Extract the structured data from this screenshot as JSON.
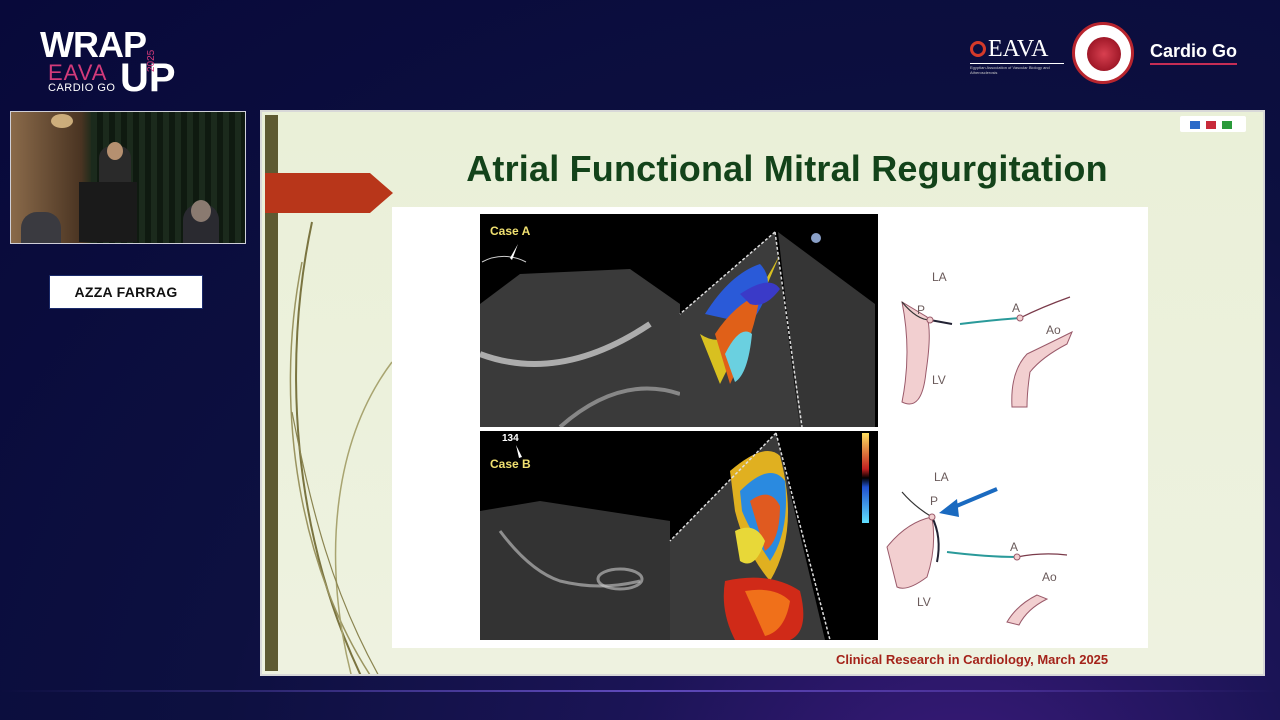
{
  "event_logo": {
    "wrap": "WRAP",
    "eava": "EAVA",
    "cardio": "CARDIO GO",
    "up": "UP",
    "year": "2025"
  },
  "sponsor_logos": {
    "eava_text": "EAVA",
    "eava_subtitle": "Egyptian Association of Vascular Biology and Atherosclerosis",
    "brand_text": "Cardio Go"
  },
  "speaker": {
    "name": "AZZA FARRAG"
  },
  "slide": {
    "title": "Atrial Functional Mitral Regurgitation",
    "case_a": "Case A",
    "case_b": "Case B",
    "case_b_angle": "134",
    "diagram_labels": {
      "la": "LA",
      "lv": "LV",
      "p": "P",
      "a": "A",
      "ao": "Ao"
    },
    "citation": "Clinical Research in Cardiology, March 2025"
  },
  "colors": {
    "accent_red": "#b8361a",
    "title_green": "#13431a",
    "brand_pink": "#c62d55",
    "citation_red": "#a4231a"
  }
}
